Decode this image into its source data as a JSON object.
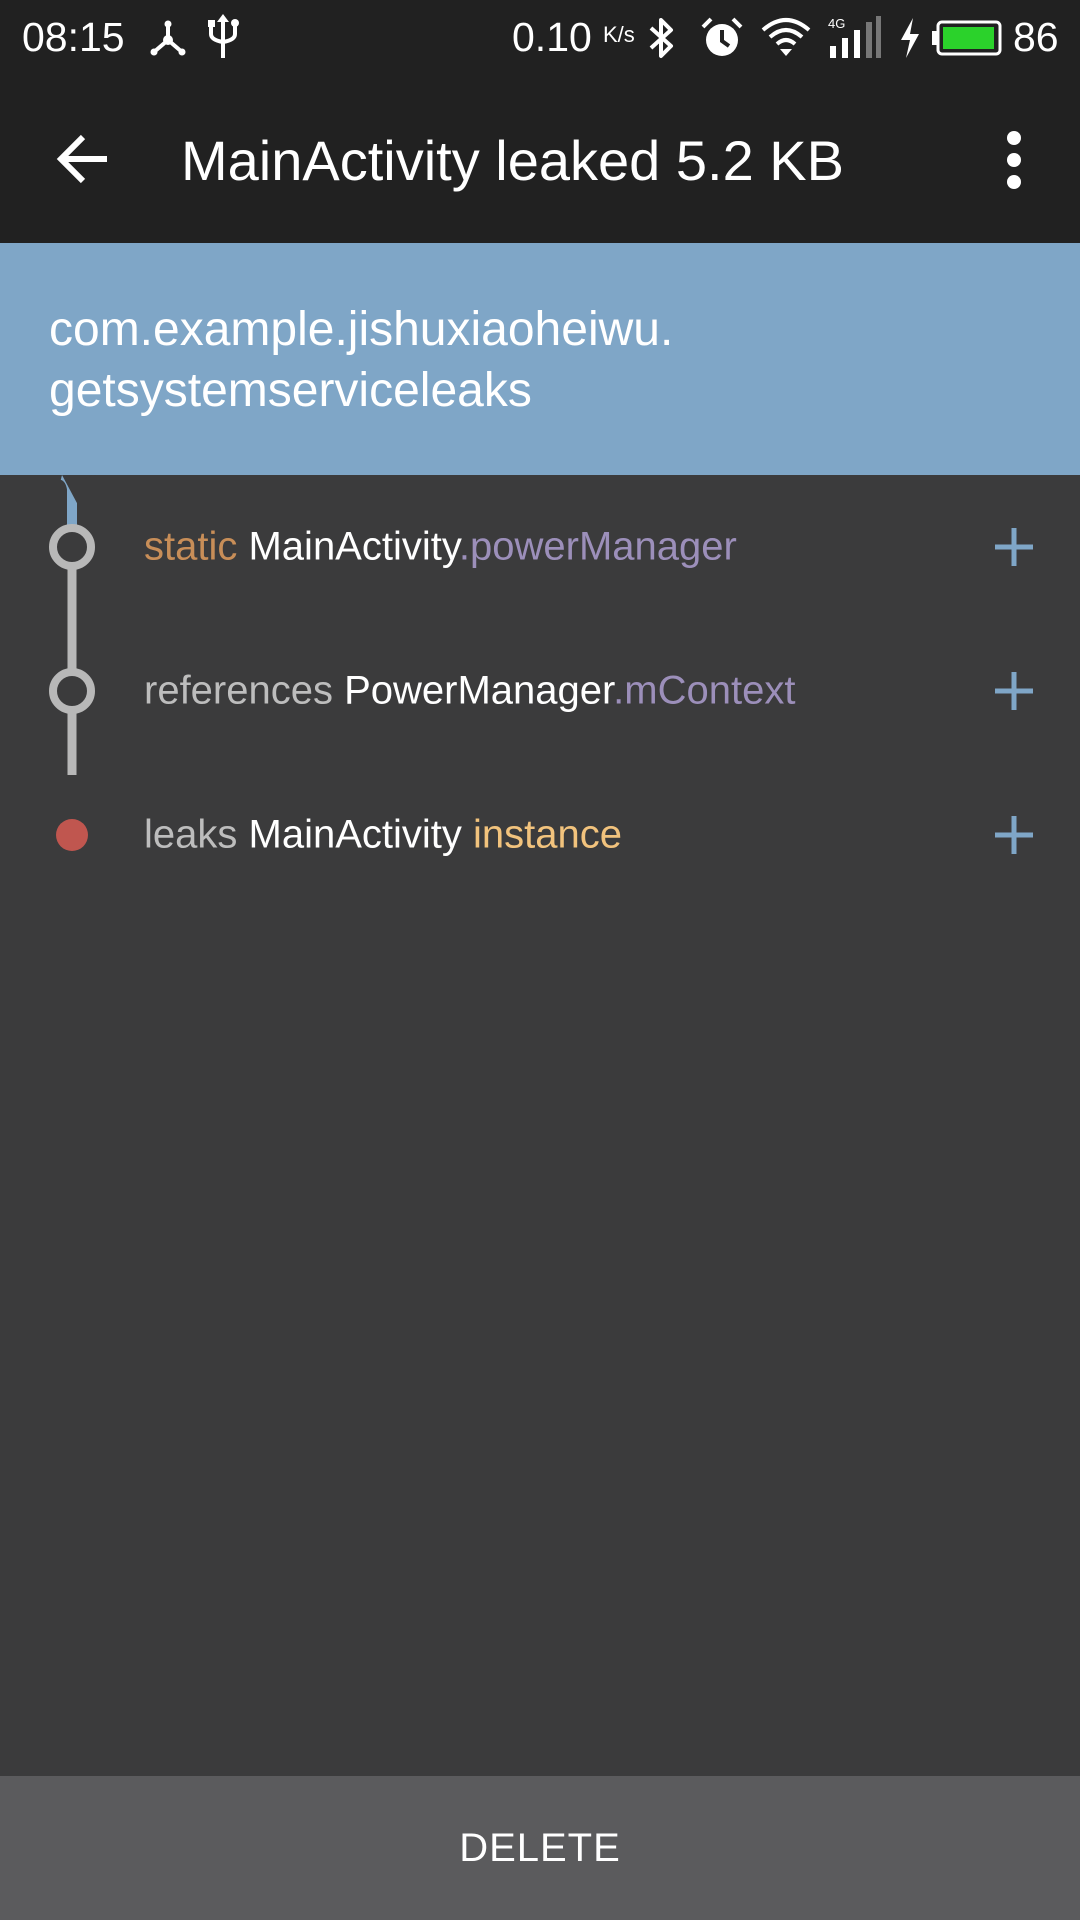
{
  "status_bar": {
    "time": "08:15",
    "net_speed": "0.10",
    "net_speed_unit": "K/s",
    "battery_percent": "86",
    "network_type": "4G",
    "icons": [
      "usb-debug-icon",
      "usb-icon",
      "bluetooth-icon",
      "alarm-icon",
      "wifi-icon",
      "signal-icon",
      "charging-icon",
      "battery-icon"
    ],
    "battery_level": 0.86,
    "battery_color": "#2bd22b"
  },
  "app_bar": {
    "title": "MainActivity leaked 5.2 KB",
    "back_icon": "arrow-back-icon",
    "menu_icon": "more-vert-icon"
  },
  "header": {
    "package_line1": "com.example.jishuxiaoheiwu.",
    "package_line2": "getsystemserviceleaks",
    "color": "#7fa6c7"
  },
  "trace": {
    "rows": [
      {
        "prefix": "static",
        "class_name": "MainActivity",
        "separator": ".",
        "member": "powerManager"
      },
      {
        "prefix": "references",
        "class_name": "PowerManager",
        "separator": ".",
        "member": "mContext"
      },
      {
        "prefix": "leaks",
        "class_name": "MainActivity",
        "separator": " ",
        "member": "instance"
      }
    ],
    "expand_icon": "plus-icon",
    "colors": {
      "static": "#c88e58",
      "field": "#9c8fba",
      "instance": "#f2c37d",
      "leak_dot": "#c0564f",
      "expand": "#7fa6c7"
    }
  },
  "footer": {
    "delete_label": "DELETE"
  }
}
